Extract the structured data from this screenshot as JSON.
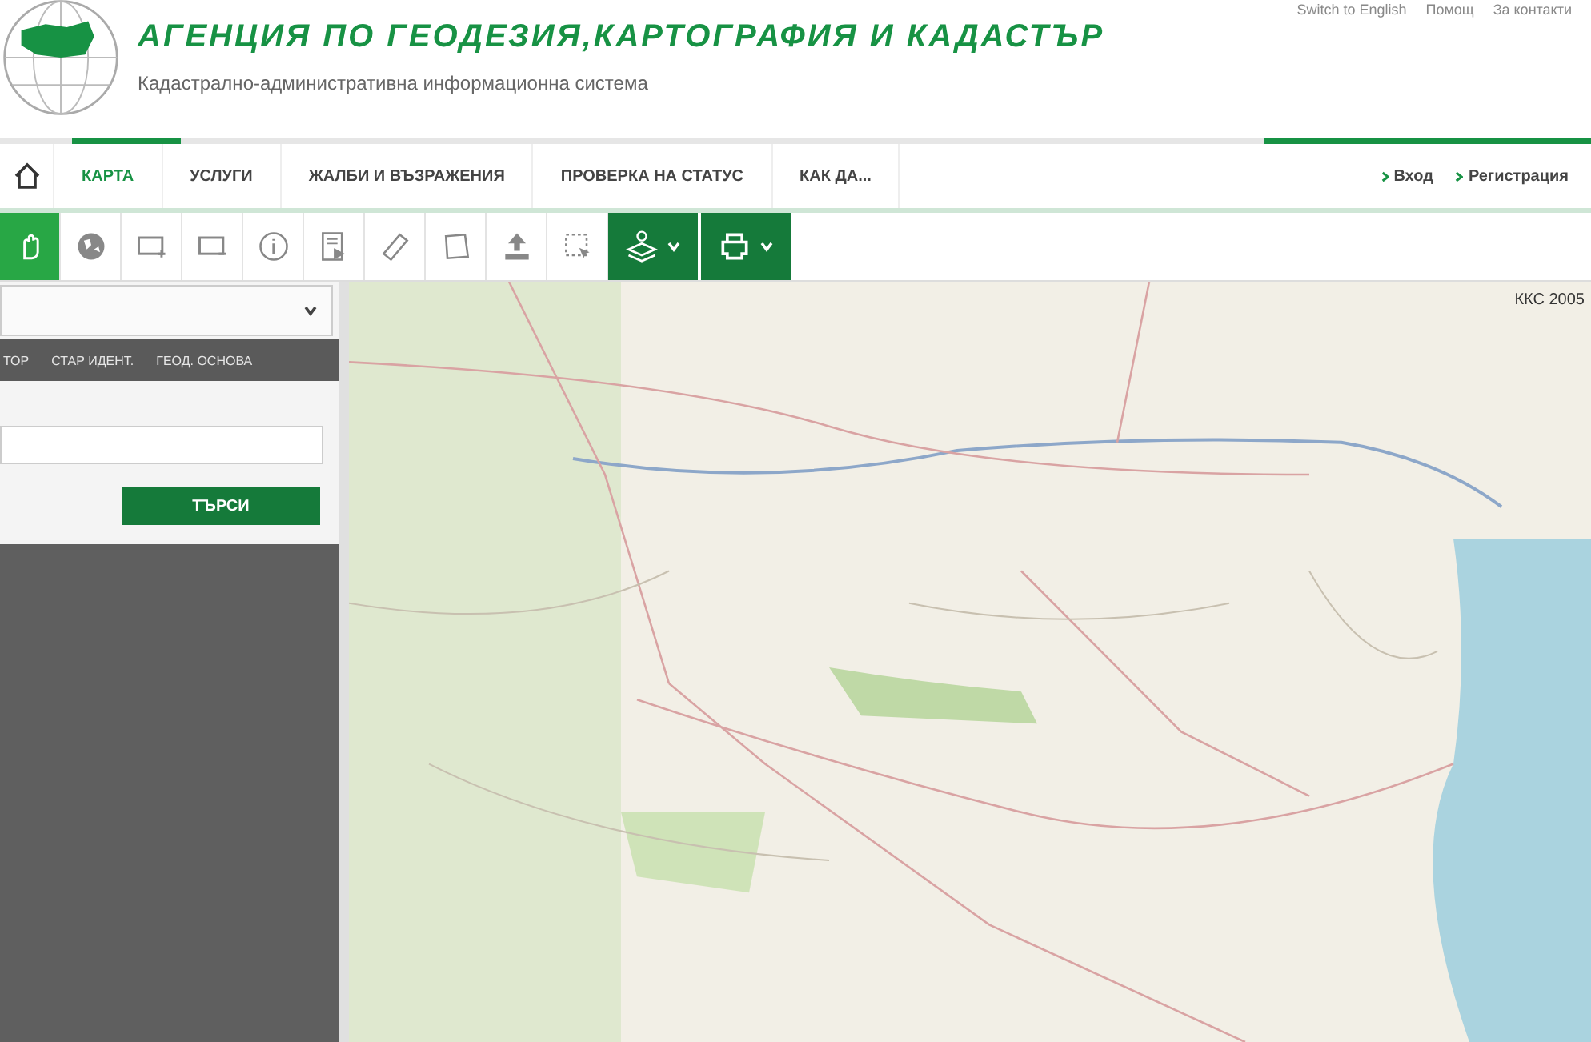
{
  "header": {
    "title": "АГЕНЦИЯ ПО ГЕОДЕЗИЯ,КАРТОГРАФИЯ И КАДАСТЪР",
    "subtitle": "Кадастрално-административна информационна система",
    "top_links": [
      "Switch to English",
      "Помощ",
      "За контакти"
    ]
  },
  "nav": {
    "tabs": [
      {
        "label": "КАРТА",
        "selected": true
      },
      {
        "label": "УСЛУГИ",
        "selected": false
      },
      {
        "label": "ЖАЛБИ И ВЪЗРАЖЕНИЯ",
        "selected": false
      },
      {
        "label": "ПРОВЕРКА НА СТАТУС",
        "selected": false
      },
      {
        "label": "КАК ДА...",
        "selected": false
      }
    ],
    "account_links": [
      "Вход",
      "Регистрация"
    ]
  },
  "toolbar": [
    {
      "kind": "hand",
      "selected": true
    },
    {
      "kind": "globe",
      "selected": false
    },
    {
      "kind": "zoom-in",
      "selected": false
    },
    {
      "kind": "zoom-out",
      "selected": false
    },
    {
      "kind": "info",
      "selected": false
    },
    {
      "kind": "document",
      "selected": false
    },
    {
      "kind": "ruler",
      "selected": false
    },
    {
      "kind": "polygon",
      "selected": false
    },
    {
      "kind": "upload",
      "selected": false
    },
    {
      "kind": "select",
      "selected": false
    },
    {
      "kind": "layers-menu"
    },
    {
      "kind": "print-menu"
    }
  ],
  "sidebar": {
    "search_tabs": [
      {
        "label": "ТОР",
        "selected": false
      },
      {
        "label": "СТАР ИДЕНТ.",
        "selected": false
      },
      {
        "label": "ГЕОД. ОСНОВА",
        "selected": false
      }
    ],
    "search_button": "ТЪРСИ"
  },
  "map": {
    "projection_label": "ККС 2005"
  }
}
